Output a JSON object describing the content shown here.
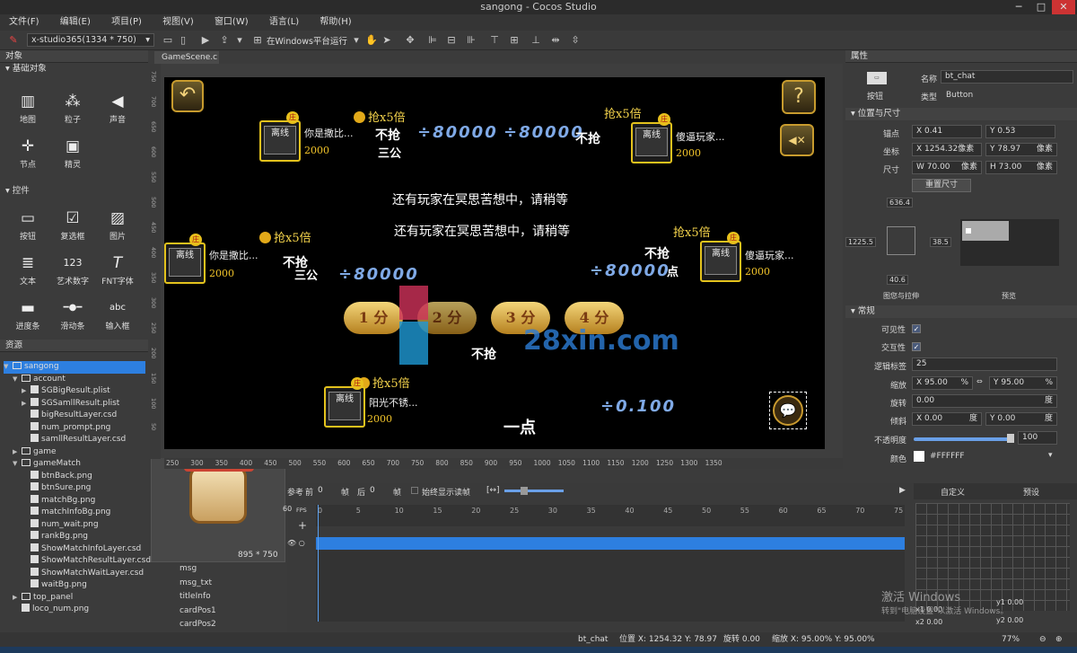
{
  "window": {
    "title": "sangong - Cocos Studio",
    "minimize": "─",
    "maximize": "□",
    "close": "✕"
  },
  "menu": [
    "文件(F)",
    "编辑(E)",
    "项目(P)",
    "视图(V)",
    "窗口(W)",
    "语言(L)",
    "帮助(H)"
  ],
  "toolbar": {
    "resolution": "x-studio365(1334 * 750)",
    "run_target": "在Windows平台运行"
  },
  "objects_panel": {
    "title": "对象",
    "basic_section": "基础对象",
    "basic_items": [
      {
        "label": "地图",
        "icon": "map-icon",
        "glyph": "▥"
      },
      {
        "label": "粒子",
        "icon": "particle-icon",
        "glyph": "⁂"
      },
      {
        "label": "声音",
        "icon": "sound-icon",
        "glyph": "◀"
      },
      {
        "label": "节点",
        "icon": "node-icon",
        "glyph": "✛"
      },
      {
        "label": "精灵",
        "icon": "sprite-icon",
        "glyph": "▣"
      }
    ],
    "controls_section": "控件",
    "control_items": [
      {
        "label": "按钮",
        "icon": "button-widget-icon",
        "glyph": "▭"
      },
      {
        "label": "复选框",
        "icon": "checkbox-widget-icon",
        "glyph": "☑"
      },
      {
        "label": "图片",
        "icon": "image-widget-icon",
        "glyph": "▨"
      },
      {
        "label": "文本",
        "icon": "text-widget-icon",
        "glyph": "≣"
      },
      {
        "label": "艺术数字",
        "icon": "art-number-icon",
        "glyph": "123"
      },
      {
        "label": "FNT字体",
        "icon": "fnt-font-icon",
        "glyph": "T"
      },
      {
        "label": "进度条",
        "icon": "progress-widget-icon",
        "glyph": "▬"
      },
      {
        "label": "滑动条",
        "icon": "slider-widget-icon",
        "glyph": "━●━"
      },
      {
        "label": "输入框",
        "icon": "input-widget-icon",
        "glyph": "abc"
      }
    ]
  },
  "resources_panel": {
    "title": "资源",
    "tree": [
      {
        "label": "sangong",
        "level": 0,
        "type": "project",
        "expanded": "▼",
        "selected": true
      },
      {
        "label": "account",
        "level": 1,
        "type": "folder",
        "expanded": "▼"
      },
      {
        "label": "SGBigResult.plist",
        "level": 2,
        "type": "file",
        "expanded": "▶"
      },
      {
        "label": "SGSamllResult.plist",
        "level": 2,
        "type": "file",
        "expanded": "▶"
      },
      {
        "label": "bigResultLayer.csd",
        "level": 2,
        "type": "file",
        "expanded": ""
      },
      {
        "label": "num_prompt.png",
        "level": 2,
        "type": "file",
        "expanded": ""
      },
      {
        "label": "samllResultLayer.csd",
        "level": 2,
        "type": "file",
        "expanded": ""
      },
      {
        "label": "game",
        "level": 1,
        "type": "folder",
        "expanded": "▶"
      },
      {
        "label": "gameMatch",
        "level": 1,
        "type": "folder",
        "expanded": "▼"
      },
      {
        "label": "btnBack.png",
        "level": 2,
        "type": "file",
        "expanded": ""
      },
      {
        "label": "btnSure.png",
        "level": 2,
        "type": "file",
        "expanded": ""
      },
      {
        "label": "matchBg.png",
        "level": 2,
        "type": "file",
        "expanded": ""
      },
      {
        "label": "matchInfoBg.png",
        "level": 2,
        "type": "file",
        "expanded": ""
      },
      {
        "label": "num_wait.png",
        "level": 2,
        "type": "file",
        "expanded": ""
      },
      {
        "label": "rankBg.png",
        "level": 2,
        "type": "file",
        "expanded": ""
      },
      {
        "label": "ShowMatchInfoLayer.csd",
        "level": 2,
        "type": "file",
        "expanded": ""
      },
      {
        "label": "ShowMatchResultLayer.csd",
        "level": 2,
        "type": "file",
        "expanded": ""
      },
      {
        "label": "ShowMatchWaitLayer.csd",
        "level": 2,
        "type": "file",
        "expanded": ""
      },
      {
        "label": "waitBg.png",
        "level": 2,
        "type": "file",
        "expanded": ""
      },
      {
        "label": "top_panel",
        "level": 1,
        "type": "folder",
        "expanded": "▶"
      },
      {
        "label": "loco_num.png",
        "level": 1,
        "type": "file",
        "expanded": ""
      }
    ],
    "preview_size": "895 * 750"
  },
  "scene_tab": {
    "label": "GameScene.c",
    "close": "×"
  },
  "game": {
    "message_line1": "还有玩家在冥思苦想中，请稍等",
    "message_line2": "还有玩家在冥思苦想中，请稍等",
    "offline_label": "离线",
    "zhuang_label": "庄",
    "seats": [
      {
        "name": "你是撒比...",
        "score": "2000",
        "bet": "抢x5倍",
        "big_bet": "80000",
        "result": "不抢",
        "points": "三公"
      },
      {
        "name": "傻逼玩家...",
        "score": "2000",
        "bet": "抢x5倍",
        "big_bet": "80000",
        "result": "不抢",
        "points": ""
      },
      {
        "name": "你是撒比...",
        "score": "2000",
        "bet": "抢x5倍",
        "big_bet": "80000",
        "result": "不抢",
        "points": "三公"
      },
      {
        "name": "傻逼玩家...",
        "score": "2000",
        "bet": "抢x5倍",
        "big_bet": "80000",
        "result": "不抢",
        "points": "点"
      },
      {
        "name": "阳光不锈...",
        "score": "2000",
        "bet": "抢x5倍",
        "big_bet": "0.100",
        "result": "",
        "points": "一点"
      }
    ],
    "multiplier_buttons": [
      "1 分",
      "2 分",
      "3 分",
      "4 分"
    ],
    "middle_result": "不抢",
    "back_icon": "↶",
    "help_label": "?",
    "mute_icon": "◀✕",
    "chat_icon": "💬",
    "watermark": "28xin.com"
  },
  "ruler_top": [
    "250",
    "300",
    "350",
    "400",
    "450",
    "500",
    "550",
    "600",
    "650",
    "700",
    "750",
    "800",
    "850",
    "900",
    "950",
    "1000",
    "1050",
    "1100",
    "1150",
    "1200",
    "1250",
    "1300",
    "1350"
  ],
  "ruler_left": [
    "750",
    "700",
    "650",
    "600",
    "550",
    "500",
    "450",
    "400",
    "350",
    "300",
    "250",
    "200",
    "150",
    "100",
    "50"
  ],
  "properties": {
    "title": "属性",
    "widget_type_label": "按钮",
    "name_label": "名称",
    "name_value": "bt_chat",
    "type_label": "类型",
    "type_value": "Button",
    "pos_size_section": "位置与尺寸",
    "anchor_label": "锚点",
    "anchor_x": "X  0.41",
    "anchor_y": "Y  0.53",
    "pos_label": "坐标",
    "pos_x": "X  1254.32像素",
    "pos_y": "Y  78.97",
    "pos_y_unit": "像素",
    "size_label": "尺寸",
    "size_w": "W  70.00",
    "size_w_unit": "像素",
    "size_h": "H  73.00",
    "size_h_unit": "像素",
    "reset_size": "重置尺寸",
    "margin_top": "636.4",
    "margin_left": "1225.5",
    "margin_right": "38.5",
    "margin_bottom": "40.6",
    "layout_label": "图您与拉伸",
    "preview_label": "预览",
    "general_section": "常规",
    "visible_label": "可见性",
    "interactive_label": "交互性",
    "logic_tag_label": "逻辑标签",
    "logic_tag_value": "25",
    "scale_label": "缩放",
    "scale_x": "X  95.00",
    "scale_y": "Y  95.00",
    "percent": "%",
    "rotation_label": "旋转",
    "rotation_value": "0.00",
    "degree": "度",
    "skew_label": "倾斜",
    "skew_x": "X  0.00",
    "skew_y": "Y  0.00",
    "opacity_label": "不透明度",
    "opacity_value": "100",
    "color_label": "颜色",
    "color_value": "#FFFFFF",
    "checkmark": "✓"
  },
  "timeline": {
    "ref_label": "参考",
    "prev_label": "前",
    "prev_value": "0",
    "frame_label": "帧",
    "next_label": "后",
    "next_value": "0",
    "frame_label2": "帧",
    "onion_label": "始终显示读帧",
    "fps_label": "FPS",
    "fps_value": "60",
    "ticks": [
      "0",
      "5",
      "10",
      "15",
      "20",
      "25",
      "30",
      "35",
      "40",
      "45",
      "50",
      "55",
      "60",
      "65",
      "70",
      "75"
    ],
    "tracks": [
      "msg",
      "msg_txt",
      "titleInfo",
      "cardPos1",
      "cardPos2"
    ],
    "custom_label": "自定义",
    "preset_label": "预设",
    "curve_x1": "x1  0.00",
    "curve_y1": "y1  0.00",
    "curve_x2": "x2  0.00",
    "curve_y2": "y2  0.00"
  },
  "status": {
    "selected": "bt_chat",
    "position": "位置 X: 1254.32  Y: 78.97",
    "rotation": "旋转 0.00",
    "scale": "缩放 X: 95.00%  Y: 95.00%",
    "zoom": "77%"
  },
  "activate_windows": {
    "line1": "激活 Windows",
    "line2": "转到\"电脑设置\"以激活 Windows。"
  }
}
